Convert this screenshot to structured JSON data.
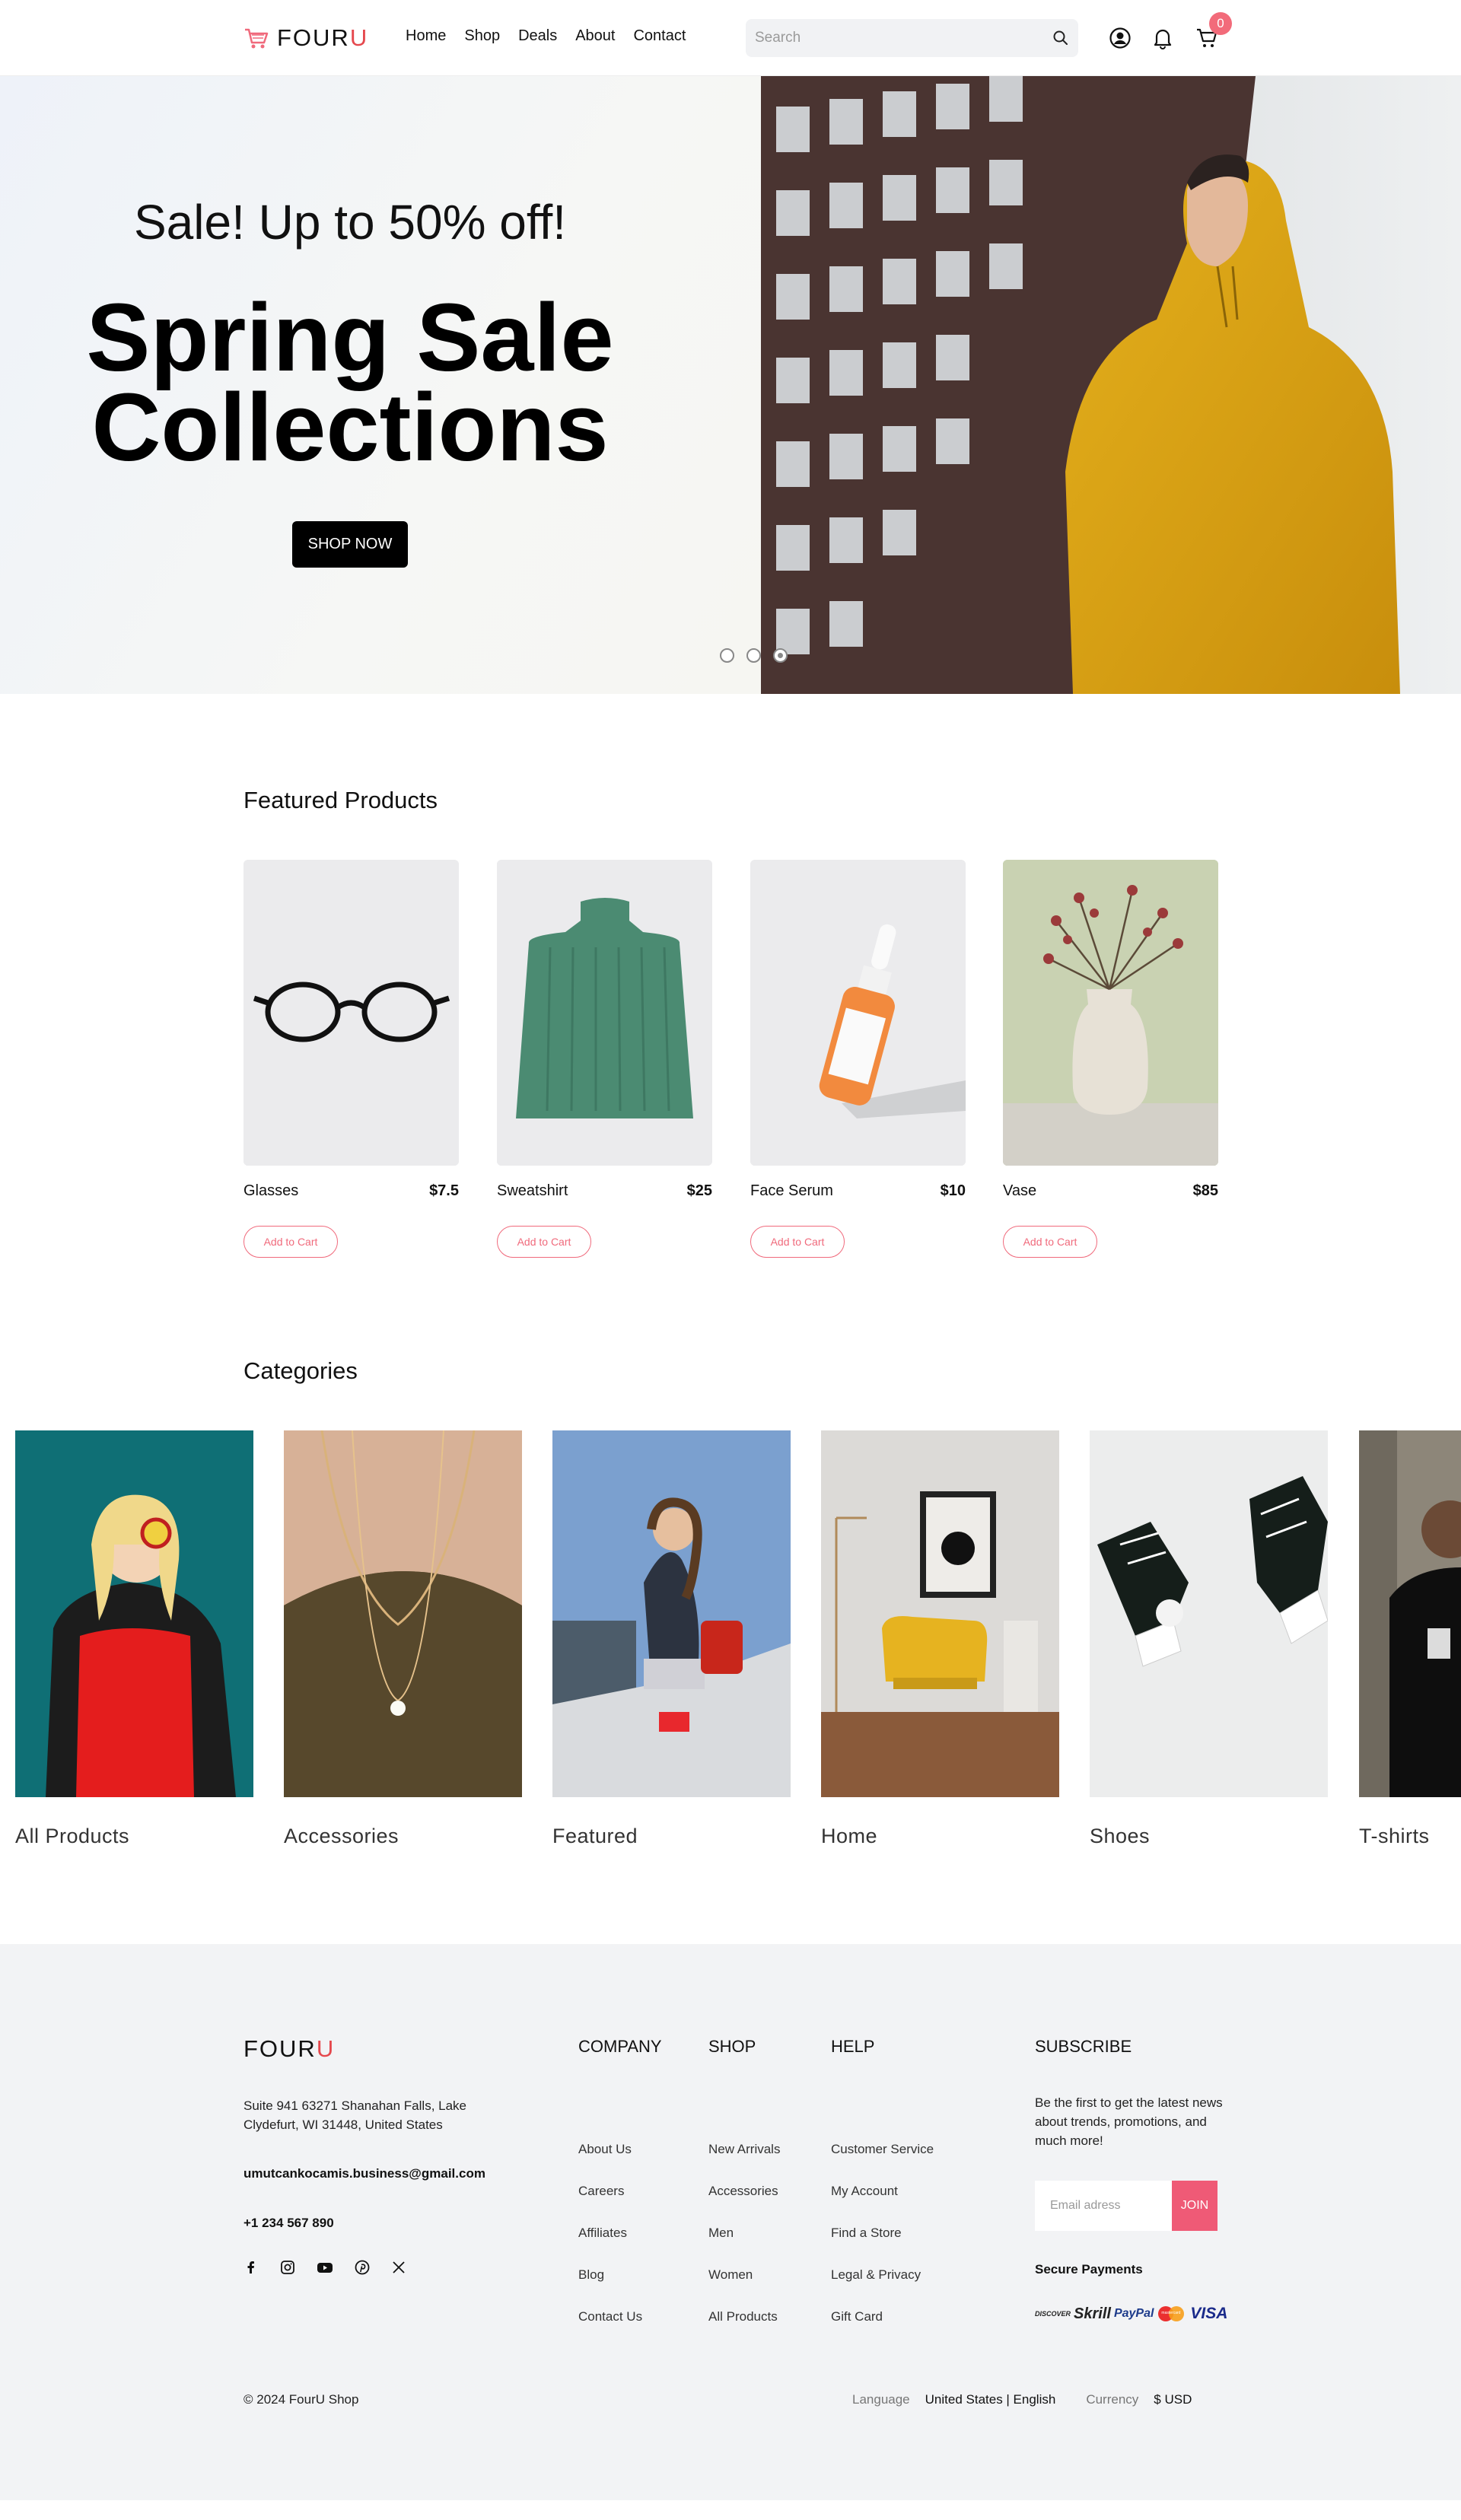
{
  "brand": {
    "name_main": "FOUR",
    "name_accent": "U"
  },
  "nav": [
    "Home",
    "Shop",
    "Deals",
    "About",
    "Contact"
  ],
  "search": {
    "placeholder": "Search"
  },
  "cart": {
    "count": "0"
  },
  "hero": {
    "subtitle": "Sale! Up to 50% off!",
    "title_line1": "Spring Sale",
    "title_line2": "Collections",
    "cta": "SHOP NOW",
    "slides": 3,
    "active_slide": 3
  },
  "featured": {
    "title": "Featured Products",
    "products": [
      {
        "name": "Glasses",
        "price": "$7.5",
        "cta": "Add to Cart"
      },
      {
        "name": "Sweatshirt",
        "price": "$25",
        "cta": "Add to Cart"
      },
      {
        "name": "Face Serum",
        "price": "$10",
        "cta": "Add to Cart"
      },
      {
        "name": "Vase",
        "price": "$85",
        "cta": "Add to Cart"
      }
    ]
  },
  "categories": {
    "title": "Categories",
    "items": [
      "All Products",
      "Accessories",
      "Featured",
      "Home",
      "Shoes",
      "T-shirts"
    ]
  },
  "footer": {
    "address": "Suite 941 63271 Shanahan Falls, Lake Clydefurt, WI 31448, United States",
    "email": "umutcankocamis.business@gmail.com",
    "phone": "+1 234 567 890",
    "social_icons": [
      "facebook-icon",
      "instagram-icon",
      "youtube-icon",
      "pinterest-icon",
      "x-icon"
    ],
    "company": {
      "title": "COMPANY",
      "links": [
        "About Us",
        "Careers",
        "Affiliates",
        "Blog",
        "Contact Us"
      ]
    },
    "shop": {
      "title": "SHOP",
      "links": [
        "New Arrivals",
        "Accessories",
        "Men",
        "Women",
        "All Products"
      ]
    },
    "help": {
      "title": "HELP",
      "links": [
        "Customer Service",
        "My Account",
        "Find a Store",
        "Legal & Privacy",
        "Gift Card"
      ]
    },
    "subscribe": {
      "title": "SUBSCRIBE",
      "text": "Be the first to get the latest news about trends, promotions, and much more!",
      "placeholder": "Email adress",
      "button": "JOIN"
    },
    "secure_payments": "Secure Payments",
    "payment_logos": [
      "DISCOVER",
      "Skrill",
      "PayPal",
      "mastercard",
      "VISA"
    ],
    "copyright": "© 2024 FourU Shop",
    "language_label": "Language",
    "language_value": "United States | English",
    "currency_label": "Currency",
    "currency_value": "$ USD"
  },
  "colors": {
    "accent": "#e5484d",
    "button_pink": "#ef5a76",
    "footer_bg": "#f2f3f5"
  }
}
